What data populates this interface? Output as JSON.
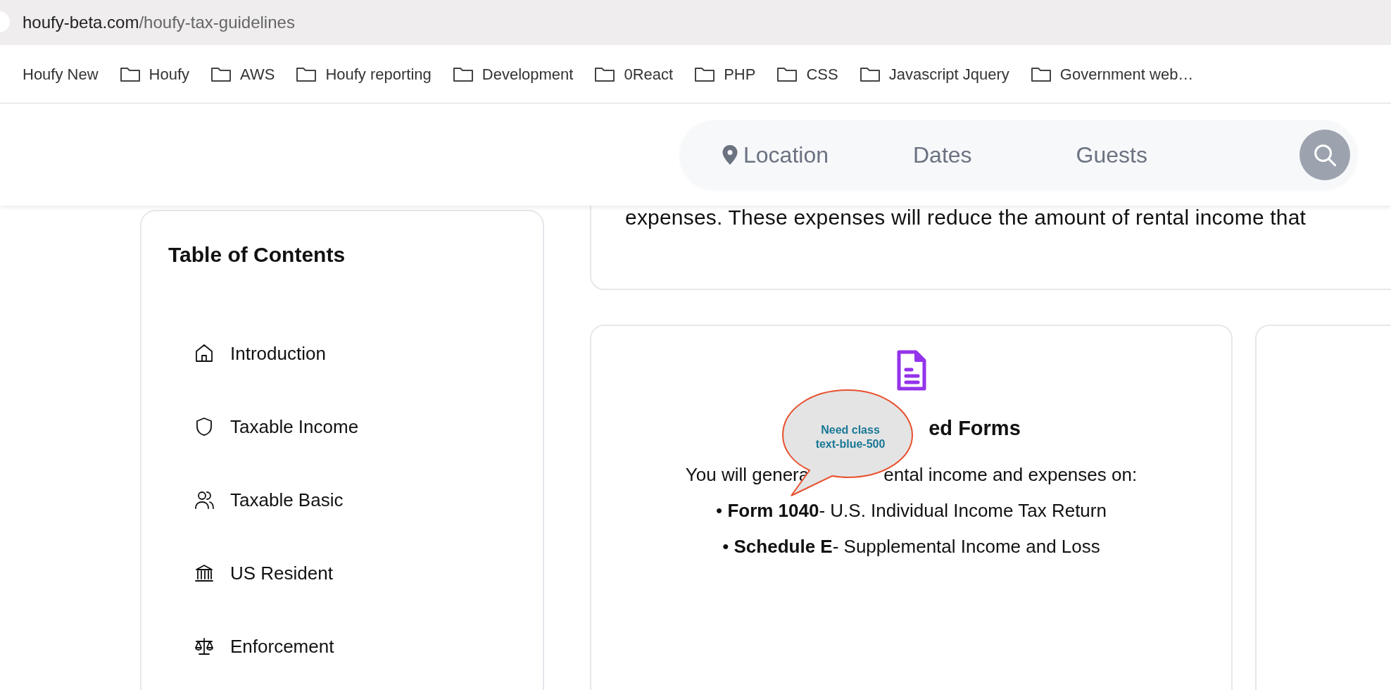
{
  "browser": {
    "url_host": "houfy-beta.com",
    "url_path": "/houfy-tax-guidelines",
    "bookmarks": [
      {
        "label": "Houfy New"
      },
      {
        "label": "Houfy"
      },
      {
        "label": "AWS"
      },
      {
        "label": "Houfy reporting"
      },
      {
        "label": "Development"
      },
      {
        "label": "0React"
      },
      {
        "label": "PHP"
      },
      {
        "label": "CSS"
      },
      {
        "label": "Javascript Jquery"
      },
      {
        "label": "Government web…"
      }
    ]
  },
  "search_bar": {
    "fields": [
      {
        "label": "Location",
        "kind": "location"
      },
      {
        "label": "Dates",
        "kind": "plain"
      },
      {
        "label": "Guests",
        "kind": "plain"
      }
    ]
  },
  "toc": {
    "title": "Table of Contents",
    "items": [
      {
        "label": "Introduction"
      },
      {
        "label": "Taxable Income"
      },
      {
        "label": "Taxable Basic"
      },
      {
        "label": "US Resident"
      },
      {
        "label": "Enforcement"
      }
    ]
  },
  "intro_card": {
    "text": "expenses. These expenses will reduce the amount of rental income that"
  },
  "forms_card": {
    "title": "ed Forms",
    "intro_parts": [
      "You will genera",
      "ental income and expenses on:"
    ],
    "items": [
      "• **Form 1040**- U.S. Individual Income Tax Return",
      "• **Schedule E**- Supplemental Income and Loss"
    ]
  },
  "annotation": {
    "lines": [
      "Need class",
      "text-blue-500"
    ]
  }
}
